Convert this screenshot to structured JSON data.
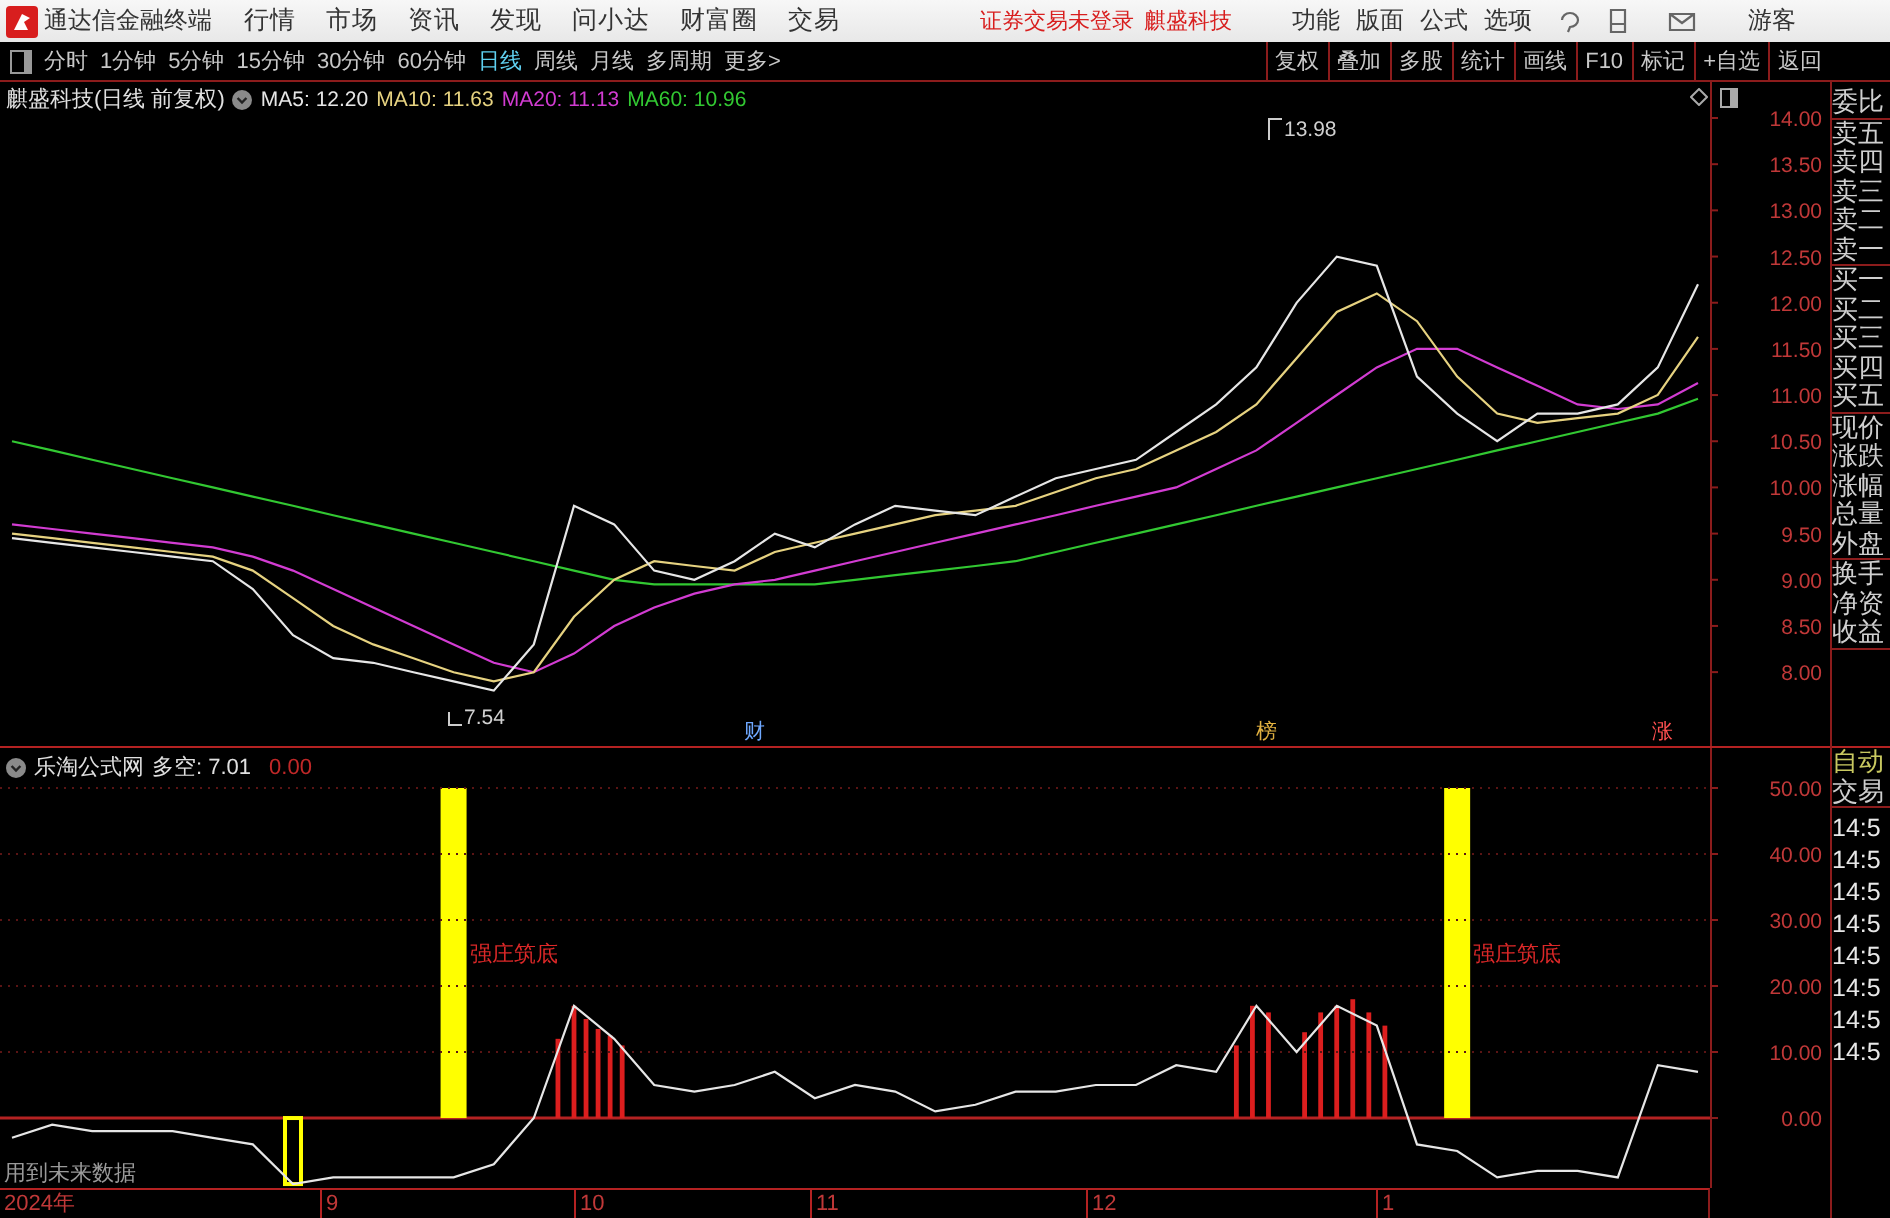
{
  "app": {
    "title": "通达信金融终端"
  },
  "menu": [
    "行情",
    "市场",
    "资讯",
    "发现",
    "问小达",
    "财富圈",
    "交易"
  ],
  "login_status": "证券交易未登录",
  "stock_link": "麒盛科技",
  "right_menu": [
    "功能",
    "版面",
    "公式",
    "选项"
  ],
  "user": "游客",
  "period_tabs": [
    {
      "label": "分时",
      "selected": false
    },
    {
      "label": "1分钟",
      "selected": false
    },
    {
      "label": "5分钟",
      "selected": false
    },
    {
      "label": "15分钟",
      "selected": false
    },
    {
      "label": "30分钟",
      "selected": false
    },
    {
      "label": "60分钟",
      "selected": false
    },
    {
      "label": "日线",
      "selected": true
    },
    {
      "label": "周线",
      "selected": false
    },
    {
      "label": "月线",
      "selected": false
    },
    {
      "label": "多周期",
      "selected": false
    },
    {
      "label": "更多>",
      "selected": false
    }
  ],
  "toolbar_buttons": [
    "复权",
    "叠加",
    "多股",
    "统计",
    "画线",
    "F10",
    "标记",
    "+自选",
    "返回"
  ],
  "price_chart": {
    "title": "麒盛科技(日线 前复权)",
    "legend": [
      {
        "label": "MA5: 12.20",
        "color": "#e6e6e6"
      },
      {
        "label": "MA10: 11.63",
        "color": "#e6d280"
      },
      {
        "label": "MA20: 11.13",
        "color": "#d23cd2"
      },
      {
        "label": "MA60: 10.96",
        "color": "#32c832"
      }
    ],
    "high_label": "13.98",
    "low_label": "7.54",
    "events": [
      {
        "text": "财",
        "color": "#6fa8ff"
      },
      {
        "text": "榜",
        "color": "#e0b040"
      },
      {
        "text": "涨",
        "color": "#ff5050"
      }
    ],
    "chart_data": {
      "type": "line",
      "ylim": [
        7.2,
        14.39
      ],
      "yticks": [
        {
          "value": 14,
          "label": "14.00"
        },
        {
          "value": 13.5,
          "label": "13.50"
        },
        {
          "value": 13,
          "label": "13.00"
        },
        {
          "value": 12.5,
          "label": "12.50"
        },
        {
          "value": 12,
          "label": "12.00"
        },
        {
          "value": 11.5,
          "label": "11.50"
        },
        {
          "value": 11,
          "label": "11.00"
        },
        {
          "value": 10.5,
          "label": "10.50"
        },
        {
          "value": 10,
          "label": "10.00"
        },
        {
          "value": 9.5,
          "label": "9.50"
        },
        {
          "value": 9,
          "label": "9.00"
        },
        {
          "value": 8.5,
          "label": "8.50"
        },
        {
          "value": 8,
          "label": "8.00"
        }
      ],
      "series": [
        {
          "color": "#32c832",
          "values": [
            10.5,
            10.4,
            10.3,
            10.2,
            10.1,
            10.0,
            9.9,
            9.8,
            9.7,
            9.6,
            9.5,
            9.4,
            9.3,
            9.2,
            9.1,
            9.0,
            8.95,
            8.95,
            8.95,
            8.95,
            8.95,
            9.0,
            9.05,
            9.1,
            9.15,
            9.2,
            9.3,
            9.4,
            9.5,
            9.6,
            9.7,
            9.8,
            9.9,
            10.0,
            10.1,
            10.2,
            10.3,
            10.4,
            10.5,
            10.6,
            10.7,
            10.8,
            10.96
          ]
        },
        {
          "color": "#d23cd2",
          "values": [
            9.6,
            9.55,
            9.5,
            9.45,
            9.4,
            9.35,
            9.25,
            9.1,
            8.9,
            8.7,
            8.5,
            8.3,
            8.1,
            8.0,
            8.2,
            8.5,
            8.7,
            8.85,
            8.95,
            9.0,
            9.1,
            9.2,
            9.3,
            9.4,
            9.5,
            9.6,
            9.7,
            9.8,
            9.9,
            10.0,
            10.2,
            10.4,
            10.7,
            11.0,
            11.3,
            11.5,
            11.5,
            11.3,
            11.1,
            10.9,
            10.85,
            10.9,
            11.13
          ]
        },
        {
          "color": "#e6d280",
          "values": [
            9.5,
            9.45,
            9.4,
            9.35,
            9.3,
            9.25,
            9.1,
            8.8,
            8.5,
            8.3,
            8.15,
            8.0,
            7.9,
            8.0,
            8.6,
            9.0,
            9.2,
            9.15,
            9.1,
            9.3,
            9.4,
            9.5,
            9.6,
            9.7,
            9.75,
            9.8,
            9.95,
            10.1,
            10.2,
            10.4,
            10.6,
            10.9,
            11.4,
            11.9,
            12.1,
            11.8,
            11.2,
            10.8,
            10.7,
            10.75,
            10.8,
            11.0,
            11.63
          ]
        },
        {
          "color": "#e6e6e6",
          "values": [
            9.45,
            9.4,
            9.35,
            9.3,
            9.25,
            9.2,
            8.9,
            8.4,
            8.15,
            8.1,
            8.0,
            7.9,
            7.8,
            8.3,
            9.8,
            9.6,
            9.1,
            9.0,
            9.2,
            9.5,
            9.35,
            9.6,
            9.8,
            9.75,
            9.7,
            9.9,
            10.1,
            10.2,
            10.3,
            10.6,
            10.9,
            11.3,
            12.0,
            12.5,
            12.4,
            11.2,
            10.8,
            10.5,
            10.8,
            10.8,
            10.9,
            11.3,
            12.2
          ]
        }
      ]
    }
  },
  "indicator": {
    "name": "乐淘公式网",
    "reading": "多空: 7.01",
    "reading_2": "0.00",
    "note": "用到未来数据",
    "date_axis": [
      "2024年",
      "9",
      "10",
      "11",
      "12",
      "1"
    ],
    "signal_labels": [
      "强庄筑底",
      "强庄筑底"
    ],
    "trend": {
      "chart_data": {
        "type": "line",
        "ylim": [
          -10.6,
          56.06
        ],
        "grid": true,
        "yticks": [
          {
            "value": 50,
            "label": "50.00"
          },
          {
            "value": 40,
            "label": "40.00"
          },
          {
            "value": 30,
            "label": "30.00"
          },
          {
            "value": 20,
            "label": "20.00"
          },
          {
            "value": 10,
            "label": "10.00"
          },
          {
            "value": 0,
            "label": "0.00"
          }
        ],
        "series": [
          {
            "color": "#e6e6e6",
            "values": [
              -3,
              -1,
              -2,
              -2,
              -2,
              -3,
              -4,
              -10,
              -9,
              -9,
              -9,
              -9,
              -7,
              0,
              17,
              12,
              5,
              4,
              5,
              7,
              3,
              5,
              4,
              1,
              2,
              4,
              4,
              5,
              5,
              8,
              7,
              17,
              10,
              17,
              14,
              -4,
              -5,
              -9,
              -8,
              -8,
              -9,
              8,
              7
            ]
          }
        ]
      }
    }
  },
  "quote_panel": {
    "groups": [
      [
        "委比"
      ],
      [
        "卖五",
        "卖四",
        "卖三",
        "卖二",
        "卖一"
      ],
      [
        "买一",
        "买二",
        "买三",
        "买四",
        "买五"
      ],
      [
        "现价",
        "涨跌",
        "涨幅",
        "总量",
        "外盘"
      ],
      [
        "换手",
        "净资",
        "收益"
      ]
    ],
    "auto_trade": [
      "自动",
      "交易"
    ],
    "times": [
      "14:5",
      "14:5",
      "14:5",
      "14:5",
      "14:5",
      "14:5",
      "14:5",
      "14:5"
    ]
  }
}
